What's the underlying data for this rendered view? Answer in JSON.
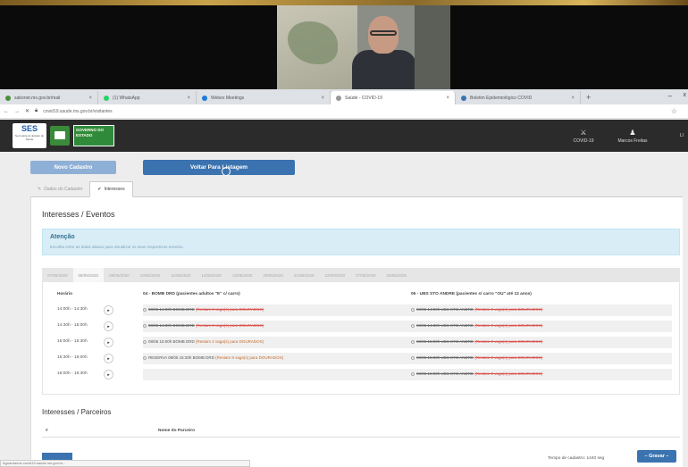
{
  "browser": {
    "tabs": [
      {
        "label": "sabonet.ms.gov.br/mail",
        "color": "#4a8f3a"
      },
      {
        "label": "(1) WhatsApp",
        "color": "#25d366"
      },
      {
        "label": "Webex Meetings",
        "color": "#1d7bd6"
      },
      {
        "label": "Saúde - COVID-19",
        "color": "#999999",
        "active": true
      },
      {
        "label": "Boletim Epidemiológico COVID",
        "color": "#3b73b0"
      }
    ],
    "new_tab": "+",
    "url": "covid19.saude.ms.gov.br/visitantes",
    "minimize": "–",
    "close": "x"
  },
  "header": {
    "logo_ses": "SES",
    "logo_ses_sub": "Secretaria de Estado de Saúde",
    "logo_gov": "GOVERNO DO ESTADO",
    "covid_label": "COVID-19",
    "user_label": "Marcos Freitas",
    "more": "LI"
  },
  "actions": {
    "novo": "Novo Cadastro",
    "voltar": "Voltar Para Listagem"
  },
  "page_tabs": [
    {
      "label": "Dados do Cadastro",
      "icon": "edit-icon"
    },
    {
      "label": "Interesses",
      "icon": "check-icon",
      "active": true
    }
  ],
  "interesses": {
    "title": "Interesses / Eventos",
    "alert_title": "Atenção",
    "alert_text": "Escolha entre as datas abaixo para visualizar os seus respectivos eventos.",
    "dates": [
      "07/05/2020",
      "08/05/2020",
      "09/05/2020",
      "10/05/2020",
      "11/05/2020",
      "12/05/2020",
      "13/05/2020",
      "20/05/2020",
      "21/05/2020",
      "22/05/2020",
      "27/05/2020",
      "29/05/2020"
    ],
    "active_date": 1,
    "col_time": "Horário",
    "col_a": "04 - BOMB DRD (pacientes adultos \"E\" c/ carro)",
    "col_b": "06 - UBS STO ANDRE (pacientes s/ carro \"OU\" até 12 anos)",
    "rows": [
      {
        "time": "14:00h - 14:30h",
        "a": {
          "label": "08/05 14:00h BOMB DRD",
          "status": "(Restam 0 vaga(s) para DOURADOS)",
          "full": true
        },
        "b": {
          "label": "08/05 14:00h UBS STO ANDRE",
          "status": "(Restam 0 vaga(s) para DOURADOS)",
          "full": true
        }
      },
      {
        "time": "14:30h - 15:00h",
        "a": {
          "label": "08/05 14:30h BOMB DRD",
          "status": "(Restam 0 vaga(s) para DOURADOS)",
          "full": true
        },
        "b": {
          "label": "08/05 14:30h UBS STO ANDRE",
          "status": "(Restam 0 vaga(s) para DOURADOS)",
          "full": true
        }
      },
      {
        "time": "15:00h - 15:30h",
        "a": {
          "label": "08/05 15:00h BOMB DRD",
          "status": "(Restam 2 vaga(s) para DOURADOS)",
          "full": false
        },
        "b": {
          "label": "08/05 15:00h UBS STO ANDRE",
          "status": "(Restam 0 vaga(s) para DOURADOS)",
          "full": true
        }
      },
      {
        "time": "15:30h - 16:00h",
        "a": {
          "label": "RESERVA 08/05 15:30h BOMB DRD",
          "status": "(Restam 8 vaga(s) para DOURADOS)",
          "full": false
        },
        "b": {
          "label": "08/05 15:30h UBS STO ANDRE",
          "status": "(Restam 0 vaga(s) para DOURADOS)",
          "full": true
        }
      },
      {
        "time": "16:00h - 16:30h",
        "a": null,
        "b": {
          "label": "08/05 16:00h UBS STO ANDRE",
          "status": "(Restam 0 vaga(s) para DOURADOS)",
          "full": true
        }
      }
    ]
  },
  "parceiros": {
    "title": "Interesses / Parceiros",
    "col_num": "#",
    "col_nome": "Nome do Parceiro"
  },
  "footer": {
    "tempo": "Tempo de cadastro: 1440 seg",
    "gravar": "– Gravar –",
    "status": "Aguardando covid19.saude.ms.gov.br..."
  }
}
